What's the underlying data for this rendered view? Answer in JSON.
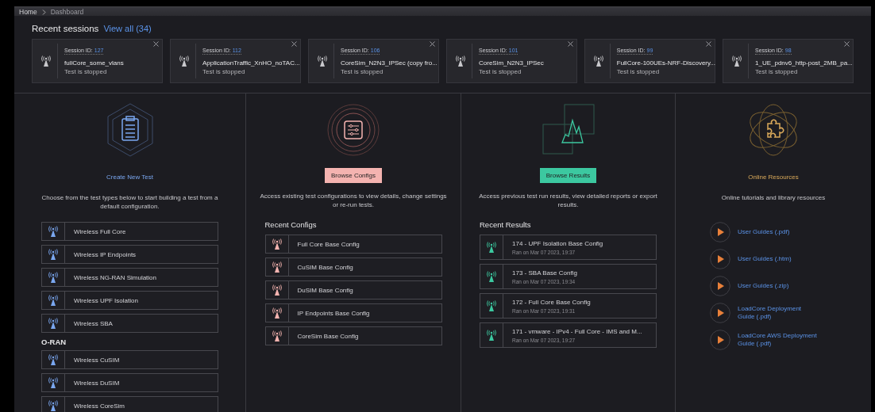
{
  "breadcrumb": [
    {
      "label": "Home"
    },
    {
      "label": "Dashboard"
    }
  ],
  "recent_sessions": {
    "title": "Recent sessions",
    "view_all": "View all (34)",
    "cards": [
      {
        "id_label": "Session ID:",
        "id": "127",
        "name": "fullCore_some_vlans",
        "status": "Test is stopped"
      },
      {
        "id_label": "Session ID:",
        "id": "112",
        "name": "ApplicationTraffic_XnHO_noTAC...",
        "status": "Test is stopped"
      },
      {
        "id_label": "Session ID:",
        "id": "106",
        "name": "CoreSim_N2N3_IPSec (copy fro...",
        "status": "Test is stopped"
      },
      {
        "id_label": "Session ID:",
        "id": "101",
        "name": "CoreSim_N2N3_IPSec",
        "status": "Test is stopped"
      },
      {
        "id_label": "Session ID:",
        "id": "99",
        "name": "FullCore-100UEs-NRF-Discovery...",
        "status": "Test is stopped"
      },
      {
        "id_label": "Session ID:",
        "id": "98",
        "name": "1_UE_pdnv6_http-post_2MB_pa...",
        "status": "Test is stopped"
      }
    ]
  },
  "panels": [
    {
      "kind": "create",
      "title": "Create New Test",
      "description": "Choose from the test types below to start building a test from a default configuration.",
      "sections": [
        {
          "items": [
            {
              "label": "Wireless Full Core"
            },
            {
              "label": "Wireless IP Endpoints"
            },
            {
              "label": "Wireless NG-RAN Simulation"
            },
            {
              "label": "Wireless UPF Isolation"
            },
            {
              "label": "Wireless SBA"
            }
          ]
        },
        {
          "heading": "O-RAN",
          "items": [
            {
              "label": "Wireless CuSIM"
            },
            {
              "label": "Wireless DuSIM"
            },
            {
              "label": "Wireless CoreSim"
            }
          ]
        }
      ]
    },
    {
      "kind": "configs",
      "title": "Browse Configs",
      "description": "Access existing test configurations to view details, change settings or re-run tests.",
      "list_title": "Recent Configs",
      "items": [
        {
          "title": "Full Core Base Config"
        },
        {
          "title": "CuSIM Base Config"
        },
        {
          "title": "DuSIM Base Config"
        },
        {
          "title": "IP Endpoints Base Config"
        },
        {
          "title": "CoreSim Base Config"
        }
      ]
    },
    {
      "kind": "results",
      "title": "Browse Results",
      "description": "Access previous test run results, view detailed reports or export results.",
      "list_title": "Recent Results",
      "items": [
        {
          "title": "174 - UPF Isolation Base Config",
          "subtitle": "Ran on Mar 07 2023, 19:37"
        },
        {
          "title": "173 - SBA Base Config",
          "subtitle": "Ran on Mar 07 2023, 19:34"
        },
        {
          "title": "172 - Full Core Base Config",
          "subtitle": "Ran on Mar 07 2023, 19:31"
        },
        {
          "title": "171 - vmware - IPv4 - Full Core - IMS and M...",
          "subtitle": "Ran on Mar 07 2023, 19:27"
        }
      ]
    },
    {
      "kind": "resources",
      "title": "Online Resources",
      "description": "Online tutorials and library resources",
      "links": [
        {
          "label": "User Guides (.pdf)"
        },
        {
          "label": "User Guides (.htm)"
        },
        {
          "label": "User Guides (.zip)"
        },
        {
          "label": "LoadCore Deployment Guide (.pdf)"
        },
        {
          "label": "LoadCore AWS Deployment Guide (.pdf)"
        }
      ]
    }
  ]
}
